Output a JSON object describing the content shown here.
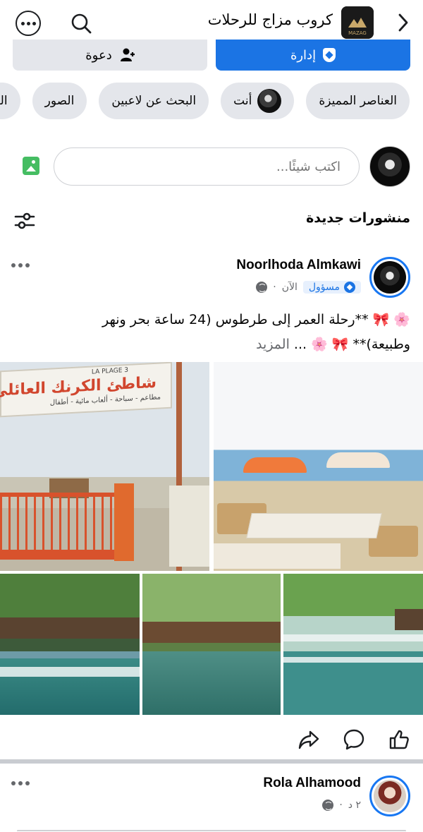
{
  "header": {
    "group_title": "كروب مزاج للرحلات",
    "logo_text": "MAZAG",
    "icons": {
      "back": "chevron-right-icon",
      "search": "search-icon",
      "more": "more-options-icon"
    }
  },
  "actions": {
    "manage_label": "إدارة",
    "invite_label": "دعوة"
  },
  "chips": [
    {
      "label": "العناصر المميزة"
    },
    {
      "label": "أنت"
    },
    {
      "label": "البحث عن لاعبين"
    },
    {
      "label": "الصور"
    },
    {
      "label": "المن"
    }
  ],
  "composer": {
    "placeholder": "اكتب شيئًا..."
  },
  "feed": {
    "section_title": "منشورات جديدة"
  },
  "posts": [
    {
      "author": "Noorlhoda Almkawi",
      "role_badge": "مسؤول",
      "time": "الآن",
      "separator": "·",
      "text_line1": "🌸 🎀 **رحلة العمر إلى طرطوس (24 ساعة بحر ونهر",
      "text_line2": "وطبيعة)** 🎀 🌸 ...",
      "see_more": "المزيد",
      "images": [
        {
          "sign_title": "شاطئ الكرنك العائلي",
          "sign_sub": "مطاعم - سباحة - ألعاب مائية - أطفال",
          "sign_top": "LA PLAGE 3"
        },
        {},
        {},
        {},
        {}
      ]
    },
    {
      "author": "Rola Alhamood",
      "time": "٢ د",
      "separator": "·"
    }
  ],
  "colors": {
    "accent": "#1b74e4",
    "chip_bg": "#e4e6eb",
    "text_secondary": "#65676b"
  }
}
